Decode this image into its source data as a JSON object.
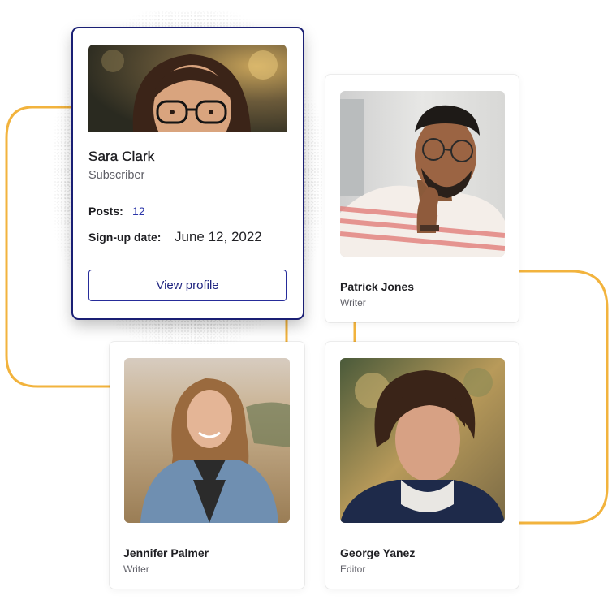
{
  "colors": {
    "connector": "#f2b33d",
    "accent": "#1a1f74",
    "post_count": "#2a34a8"
  },
  "featured": {
    "name": "Sara Clark",
    "role": "Subscriber",
    "posts_label": "Posts:",
    "posts_value": "12",
    "signup_label": "Sign-up date:",
    "signup_value": "June 12, 2022",
    "button_label": "View profile"
  },
  "users": [
    {
      "name": "Patrick Jones",
      "role": "Writer"
    },
    {
      "name": "Jennifer Palmer",
      "role": "Writer"
    },
    {
      "name": "George Yanez",
      "role": "Editor"
    }
  ]
}
